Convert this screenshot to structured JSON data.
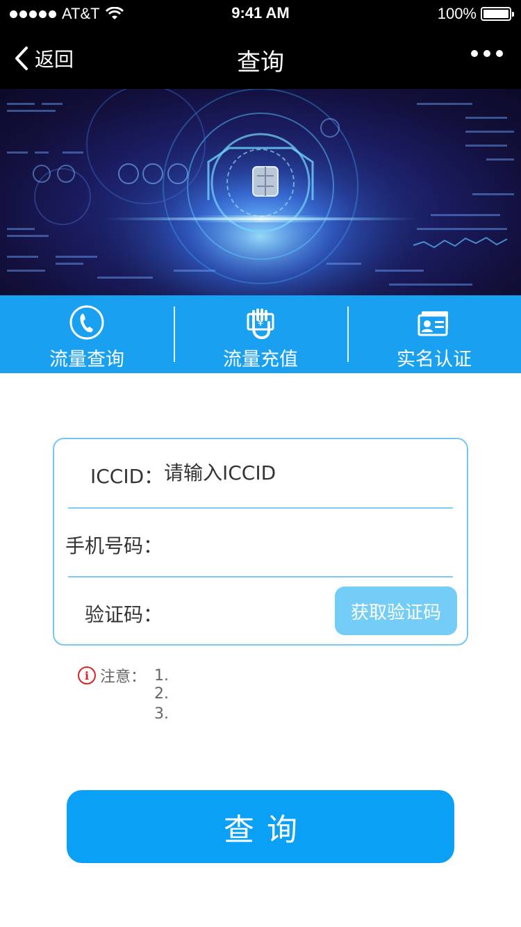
{
  "status_bar": {
    "carrier": "AT&T",
    "time": "9:41 AM",
    "battery": "100%",
    "battery_level": 1.0
  },
  "nav": {
    "back_label": "返回",
    "title": "查询"
  },
  "tabs": [
    {
      "label": "流量查询",
      "icon": "phone-icon"
    },
    {
      "label": "流量充值",
      "icon": "recharge-icon"
    },
    {
      "label": "实名认证",
      "icon": "id-card-icon"
    }
  ],
  "form": {
    "iccid_label": "ICCID：",
    "iccid_placeholder": "请输入ICCID",
    "phone_label": "手机号码：",
    "phone_value": "",
    "code_label": "验证码：",
    "code_value": "",
    "get_code_button": "获取验证码"
  },
  "notes": {
    "title": "注意：",
    "items": [
      "1.",
      "2.",
      "3."
    ]
  },
  "submit_button": "查询",
  "colors": {
    "accent": "#1aa0f0",
    "button": "#0aa0f5",
    "border": "#75c6f2",
    "warning": "#e02020"
  }
}
